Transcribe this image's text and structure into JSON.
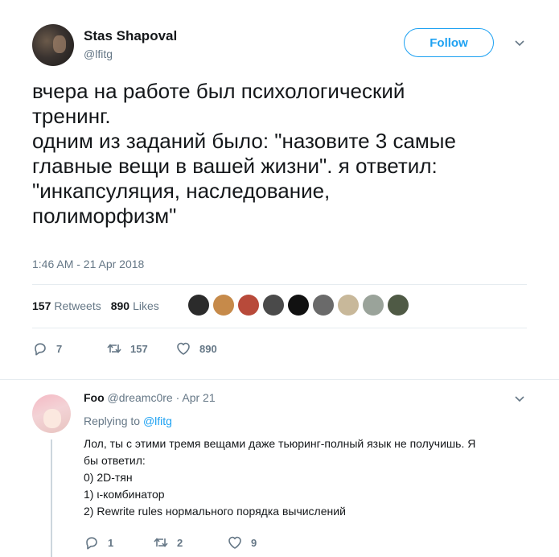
{
  "tweet": {
    "author_name": "Stas Shapoval",
    "author_handle": "@lfitg",
    "follow_label": "Follow",
    "text": "вчера на работе был психологический\nтренинг.\nодним из заданий было: \"назовите 3 самые\nглавные вещи в вашей жизни\". я ответил:\n\"инкапсуляция, наследование,\nполиморфизм\"",
    "timestamp": "1:46 AM - 21 Apr 2018",
    "retweets_count": "157",
    "retweets_label": "Retweets",
    "likes_count": "890",
    "likes_label": "Likes",
    "likers": [
      {
        "color": "#2b2b2b"
      },
      {
        "color": "#c68a4a"
      },
      {
        "color": "#b84a3a"
      },
      {
        "color": "#4a4a4a"
      },
      {
        "color": "#111111"
      },
      {
        "color": "#6a6a6a"
      },
      {
        "color": "#c8b89a"
      },
      {
        "color": "#9aa39a"
      },
      {
        "color": "#4f5a45"
      }
    ],
    "actions": {
      "replies": "7",
      "retweets": "157",
      "likes": "890"
    }
  },
  "reply": {
    "author_name": "Foo",
    "author_handle": "@dreamc0re",
    "date": "· Apr 21",
    "replying_prefix": "Replying to",
    "replying_handle": "@lfitg",
    "lines": [
      "Лол, ты с этими тремя вещами даже тьюринг-полный язык не получишь. Я",
      "бы ответил:",
      "0) 2D-тян",
      "1) ι-комбинатор",
      "2) Rewrite rules нормального порядка вычислений"
    ],
    "actions": {
      "replies": "1",
      "retweets": "2",
      "likes": "9"
    }
  },
  "colors": {
    "accent": "#1da1f2",
    "secondary_text": "#657786",
    "divider": "#e6ecf0"
  }
}
